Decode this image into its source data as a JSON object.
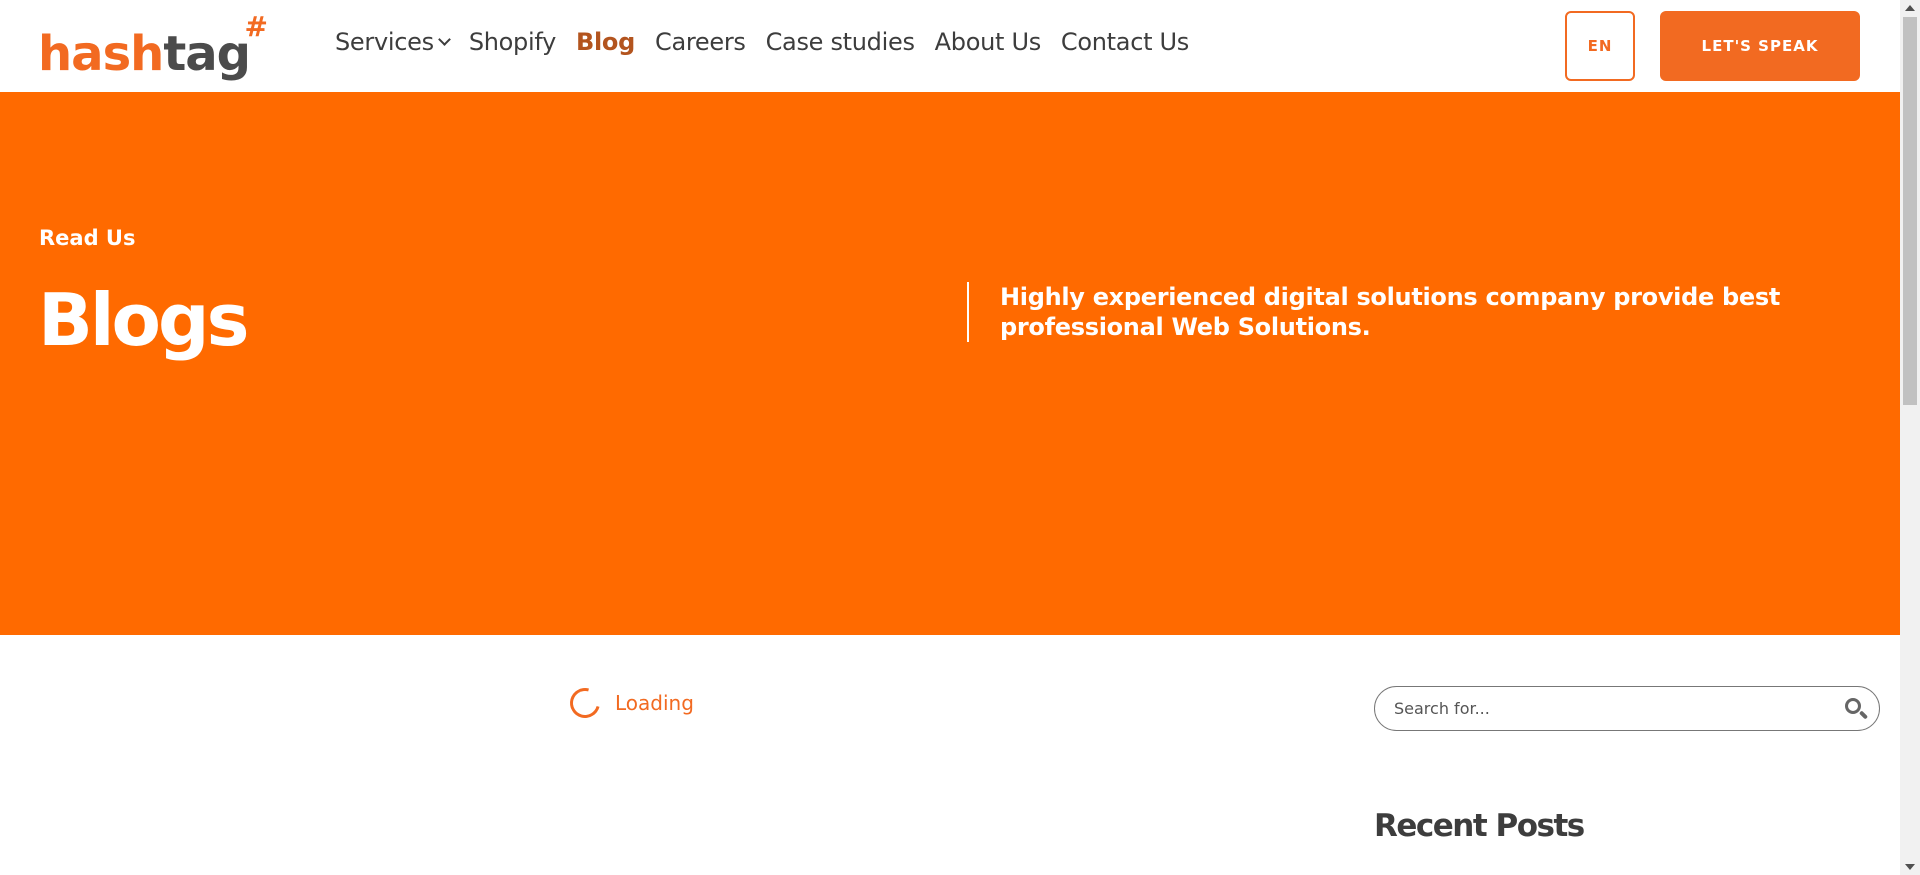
{
  "header": {
    "logo": {
      "part1": "hash",
      "part2": "tag",
      "mark": "#"
    },
    "nav": [
      {
        "label": "Services",
        "has_dropdown": true,
        "active": false
      },
      {
        "label": "Shopify",
        "active": false
      },
      {
        "label": "Blog",
        "active": true
      },
      {
        "label": "Careers",
        "active": false
      },
      {
        "label": "Case studies",
        "active": false
      },
      {
        "label": "About Us",
        "active": false
      },
      {
        "label": "Contact Us",
        "active": false
      }
    ],
    "language_label": "EN",
    "cta_label": "LET'S SPEAK"
  },
  "hero": {
    "eyebrow": "Read Us",
    "title": "Blogs",
    "description": "Highly experienced digital solutions company provide best professional Web Solutions."
  },
  "main": {
    "loading_text": "Loading"
  },
  "sidebar": {
    "search_placeholder": "Search for...",
    "recent_posts_title": "Recent Posts"
  },
  "colors": {
    "brand_orange": "#f26a21",
    "hero_background": "#ff6a00",
    "active_nav": "#b3541e",
    "text_dark": "#3d3d3d"
  },
  "icons": {
    "dropdown": "chevron-down-icon",
    "search": "search-icon",
    "loading": "spinner-icon"
  }
}
